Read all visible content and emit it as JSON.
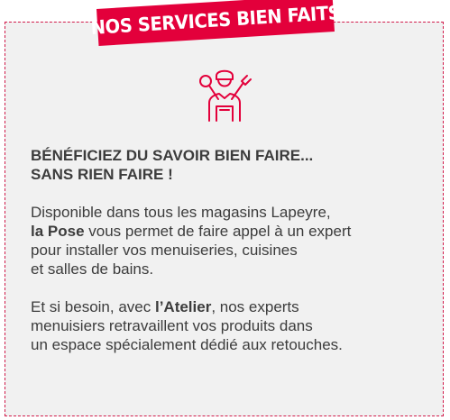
{
  "banner": {
    "label": "NOS SERVICES BIEN FAITS"
  },
  "colors": {
    "accent": "#e3003b",
    "border": "#d11b4b",
    "background": "#f1f1f1",
    "text": "#3c3c3c"
  },
  "icon": {
    "name": "technician-with-wrenches-icon"
  },
  "heading": {
    "line1": "BÉNÉFICIEZ DU SAVOIR BIEN FAIRE...",
    "line2": "SANS RIEN FAIRE !"
  },
  "paragraph1": {
    "line1": "Disponible dans tous les magasins Lapeyre,",
    "line2_bold": "la Pose",
    "line2_rest": " vous permet de faire appel à un expert",
    "line3": "pour installer vos menuiseries, cuisines",
    "line4": "et salles de bains."
  },
  "paragraph2": {
    "line1_start": "Et si besoin, avec ",
    "line1_bold": "l’Atelier",
    "line1_rest": ", nos experts",
    "line2": "menuisiers retravaillent vos produits dans",
    "line3": "un espace spécialement dédié aux retouches."
  }
}
